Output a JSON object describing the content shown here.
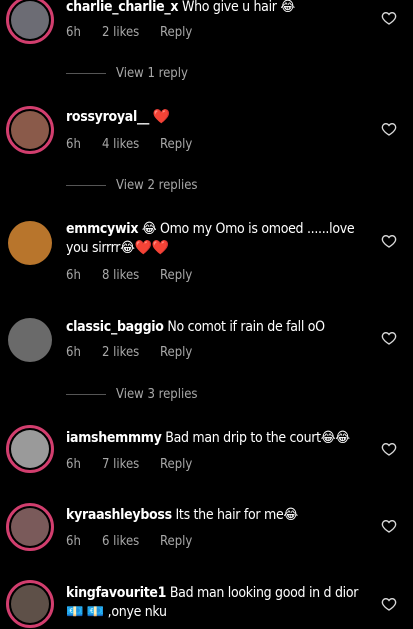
{
  "comments": [
    {
      "user": "charlie_charlie_x",
      "text": "Who give u hair 😂",
      "time": "6h",
      "likes": "2 likes",
      "reply": "Reply",
      "view": "View 1 reply",
      "av": "#6c6c74"
    },
    {
      "user": "rossyroyal__",
      "text": "❤️",
      "time": "6h",
      "likes": "4 likes",
      "reply": "Reply",
      "view": "View 2 replies",
      "av": "#8a5a4a"
    },
    {
      "user": "emmcywix",
      "text": "😂 Omo my Omo is omoed ......love you sirrrr😂❤️❤️",
      "time": "6h",
      "likes": "8 likes",
      "reply": "Reply",
      "av": "#b8752c"
    },
    {
      "user": "classic_baggio",
      "text": "No comot if rain de fall oO",
      "time": "6h",
      "likes": "2 likes",
      "reply": "Reply",
      "view": "View 3 replies",
      "av": "#6a6a6a"
    },
    {
      "user": "iamshemmmy",
      "text": "Bad man drip to the court😂😂",
      "time": "6h",
      "likes": "7 likes",
      "reply": "Reply",
      "av": "#9a9a9a"
    },
    {
      "user": "kyraashleyboss",
      "text": "Its the hair for me😂",
      "time": "6h",
      "likes": "6 likes",
      "reply": "Reply",
      "av": "#7a5a5a"
    },
    {
      "user": "kingfavourite1",
      "text": "Bad man looking good in d dior💶 💶 ,onye nku",
      "av": "#5e5048"
    }
  ]
}
